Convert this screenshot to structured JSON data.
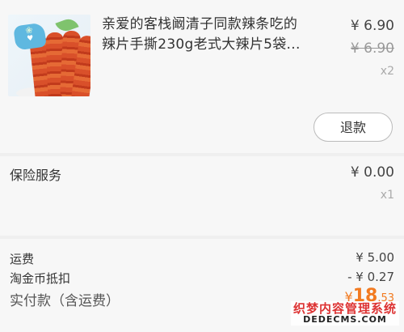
{
  "product": {
    "title": "亲爱的客栈阚清子同款辣条吃的辣片手撕230g老式大辣片5袋...",
    "price": "¥ 6.90",
    "original_price": "¥ 6.90",
    "quantity": "x2",
    "refund_label": "退款",
    "thumbnail_badge_icon": "brand-badge-icon"
  },
  "insurance": {
    "label": "保险服务",
    "price": "¥ 0.00",
    "quantity": "x1"
  },
  "summary": {
    "shipping_label": "运费",
    "shipping_value": "¥ 5.00",
    "coin_label": "淘金币抵扣",
    "coin_value": "- ¥ 0.27",
    "total_label": "实付款（含运费）",
    "total_currency": "¥",
    "total_integer": "18",
    "total_decimal": ".53",
    "accent_color": "#f27a20"
  },
  "watermark": {
    "line1": "织梦内容管理系统",
    "line2": "DEDECMS.COM"
  }
}
